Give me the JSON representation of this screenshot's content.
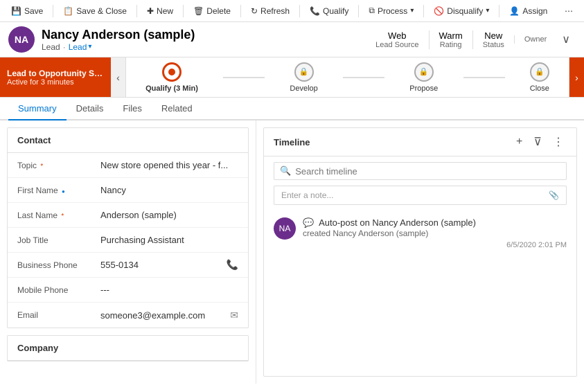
{
  "toolbar": {
    "save_label": "Save",
    "save_close_label": "Save & Close",
    "new_label": "New",
    "delete_label": "Delete",
    "refresh_label": "Refresh",
    "qualify_label": "Qualify",
    "process_label": "Process",
    "disqualify_label": "Disqualify",
    "assign_label": "Assign",
    "more_icon": "⋯"
  },
  "header": {
    "avatar_initials": "NA",
    "name": "Nancy Anderson (sample)",
    "type1": "Lead",
    "dot": "·",
    "type2": "Lead",
    "meta": [
      {
        "value": "Web",
        "label": "Lead Source"
      },
      {
        "value": "Warm",
        "label": "Rating"
      },
      {
        "value": "New",
        "label": "Status"
      },
      {
        "value": "",
        "label": "Owner"
      }
    ],
    "chevron": "∨"
  },
  "process_bar": {
    "alert_title": "Lead to Opportunity Sale...",
    "alert_sub": "Active for 3 minutes",
    "nav_left": "‹",
    "nav_right": "›",
    "steps": [
      {
        "label": "Qualify (3 Min)",
        "state": "active",
        "time": "3 Min"
      },
      {
        "label": "Develop",
        "state": "locked"
      },
      {
        "label": "Propose",
        "state": "locked"
      },
      {
        "label": "Close",
        "state": "locked"
      }
    ]
  },
  "tabs": [
    {
      "label": "Summary",
      "active": true
    },
    {
      "label": "Details",
      "active": false
    },
    {
      "label": "Files",
      "active": false
    },
    {
      "label": "Related",
      "active": false
    }
  ],
  "contact_section": {
    "title": "Contact",
    "fields": [
      {
        "label": "Topic",
        "required": true,
        "value": "New store opened this year - f...",
        "action": ""
      },
      {
        "label": "First Name",
        "required": false,
        "value": "Nancy",
        "action": "",
        "optional_dot": true
      },
      {
        "label": "Last Name",
        "required": true,
        "value": "Anderson (sample)",
        "action": ""
      },
      {
        "label": "Job Title",
        "required": false,
        "value": "Purchasing Assistant",
        "action": ""
      },
      {
        "label": "Business Phone",
        "required": false,
        "value": "555-0134",
        "action": "phone"
      },
      {
        "label": "Mobile Phone",
        "required": false,
        "value": "---",
        "action": ""
      },
      {
        "label": "Email",
        "required": false,
        "value": "someone3@example.com",
        "action": "email"
      }
    ]
  },
  "company_section": {
    "title": "Company"
  },
  "timeline": {
    "title": "Timeline",
    "search_placeholder": "Search timeline",
    "note_placeholder": "Enter a note...",
    "plus_icon": "+",
    "filter_icon": "⊿",
    "more_icon": "⋮",
    "attach_icon": "📎",
    "entries": [
      {
        "avatar_initials": "NA",
        "prefix": "Auto-post on ",
        "subject": "Nancy Anderson (sample)",
        "sub_prefix": "created ",
        "sub_value": "Nancy Anderson (sample)",
        "timestamp": "6/5/2020 2:01 PM"
      }
    ]
  }
}
